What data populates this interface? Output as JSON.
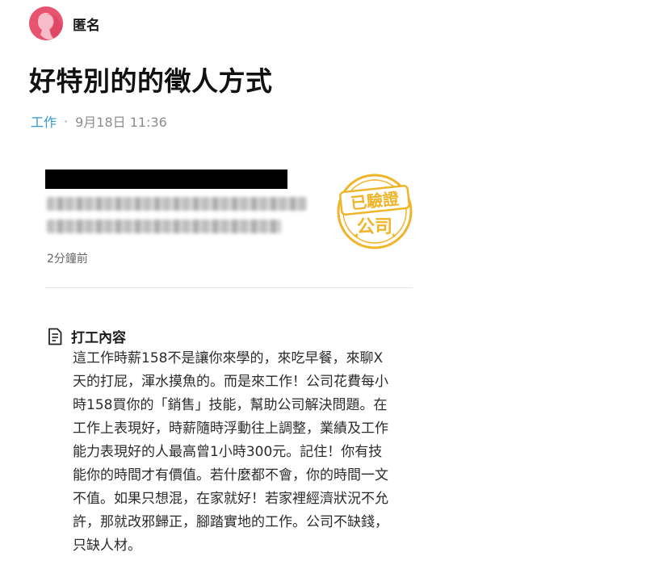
{
  "author": {
    "name": "匿名",
    "avatar_icon": "female-silhouette-icon",
    "avatar_color": "#e8536f"
  },
  "post": {
    "title": "好特別的的徵人方式",
    "board": "工作",
    "separator": "·",
    "timestamp": "9月18日 11:36"
  },
  "job_card": {
    "posted_ago": "2分鐘前",
    "stamp_line1": "已驗證",
    "stamp_line2": "公司",
    "stamp_color": "#f0b429"
  },
  "content": {
    "icon": "document-icon",
    "heading": "打工內容",
    "body": "這工作時薪158不是讓你來學的，來吃早餐，來聊X\n天的打屁，渾水摸魚的。而是來工作！公司花費每小\n時158買你的「銷售」技能，幫助公司解決問題。在\n工作上表現好，時薪隨時浮動往上調整，業績及工作\n能力表現好的人最高曾1小時300元。記住！你有技\n能你的時間才有價值。若什麼都不會，你的時間一文\n不值。如果只想混，在家就好！若家裡經濟狀況不允\n許，那就改邪歸正，腳踏實地的工作。公司不缺錢，\n只缺人材。"
  }
}
